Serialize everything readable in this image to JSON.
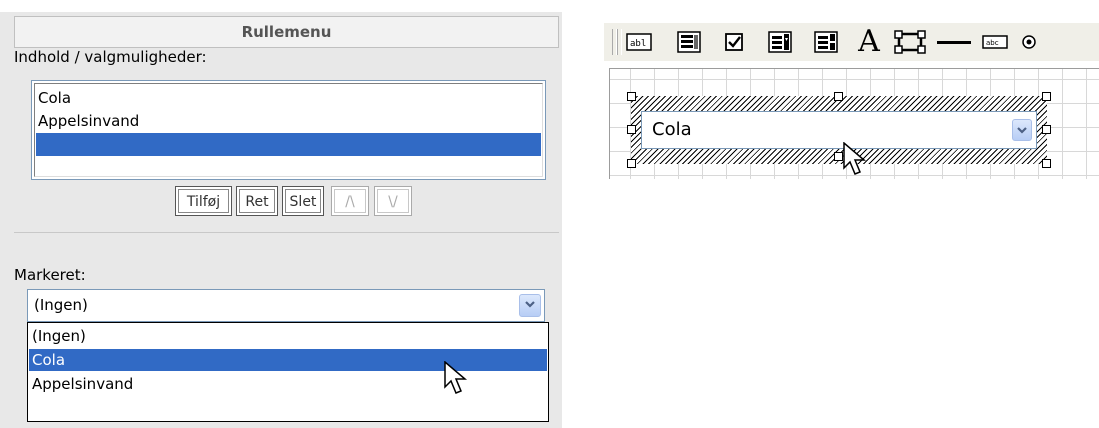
{
  "panel": {
    "title": "Rullemenu",
    "content_label": "Indhold / valgmuligheder:",
    "list_items": [
      "Cola",
      "Appelsinvand",
      ""
    ],
    "selected_list_index": 2,
    "buttons": {
      "add": "Tilføj",
      "edit": "Ret",
      "delete": "Slet",
      "up": "/\\",
      "down": "\\/"
    },
    "marked_label": "Markeret:",
    "marked_value": "(Ingen)",
    "dropdown_options": [
      "(Ingen)",
      "Cola",
      "Appelsinvand"
    ],
    "dropdown_highlight_index": 1
  },
  "designer": {
    "toolbar_tools": [
      "text-field-icon",
      "list-box-icon",
      "checkbox-icon",
      "combo-box-icon",
      "form-list-icon",
      "label-text-icon",
      "rectangle-icon",
      "line-icon",
      "button-icon",
      "radio-button-icon"
    ],
    "toolbar_text_tool": "A",
    "textfield_icon_text": "abl",
    "button_icon_text": "abc",
    "selected_control_value": "Cola"
  },
  "colors": {
    "selection": "#316ac5",
    "panel_bg": "#e8e8e8",
    "combo_border": "#7a99b8",
    "combo_button": "#b7cdf5"
  }
}
